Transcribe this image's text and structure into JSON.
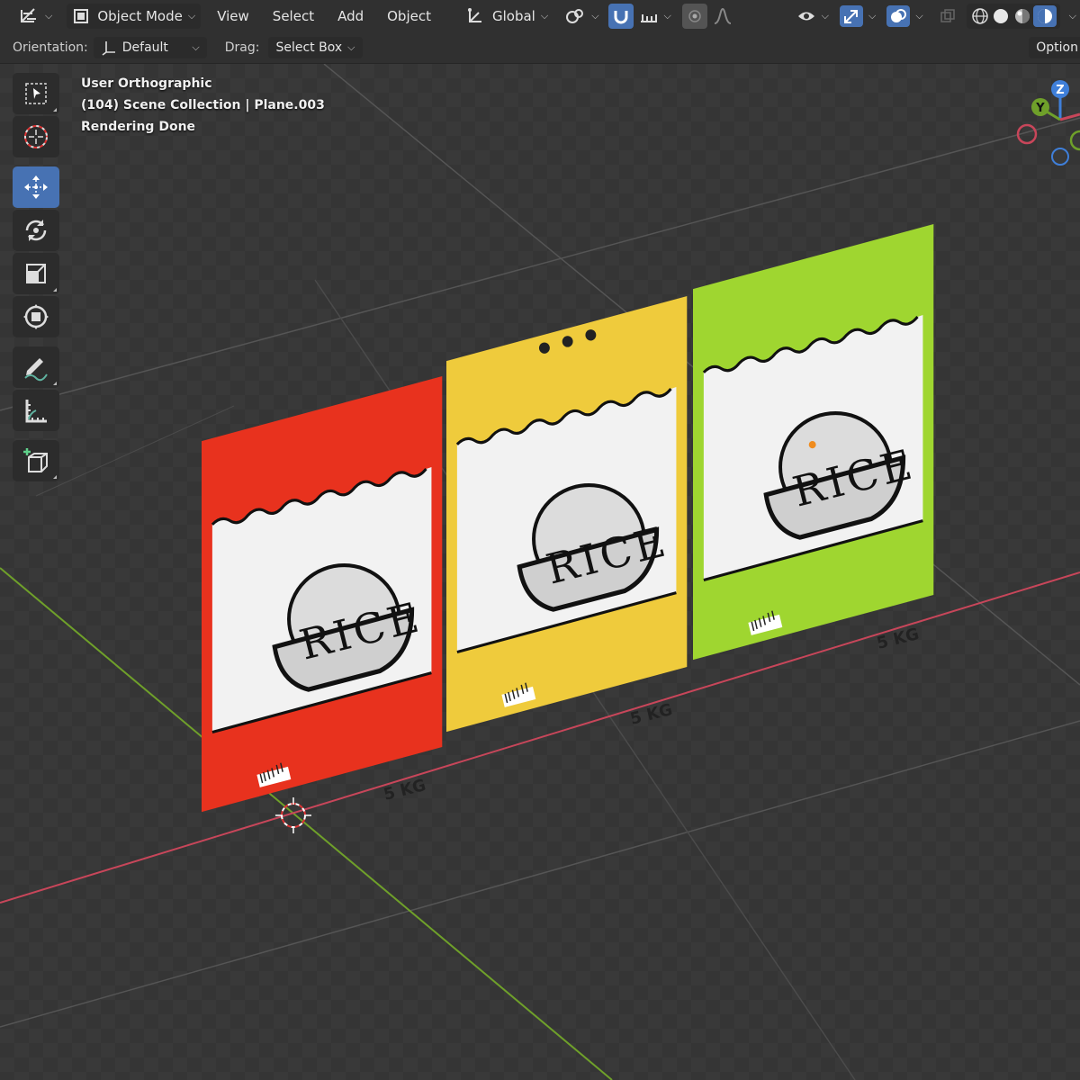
{
  "header": {
    "mode_label": "Object Mode",
    "menus": [
      "View",
      "Select",
      "Add",
      "Object"
    ],
    "transform_orientation": "Global",
    "options_label": "Option"
  },
  "tool_settings": {
    "orientation_label": "Orientation:",
    "orientation_value": "Default",
    "drag_label": "Drag:",
    "drag_value": "Select Box"
  },
  "viewport": {
    "view_name": "User Orthographic",
    "collection_info": "(104) Scene Collection | Plane.003",
    "status": "Rendering Done"
  },
  "gizmo": {
    "z_label": "Z",
    "y_label": "Y"
  },
  "bags": [
    {
      "label": "RICE",
      "weight": "5 KG",
      "color": "#e8321e"
    },
    {
      "label": "RICE",
      "weight": "5 KG",
      "color": "#efcb3c"
    },
    {
      "label": "RICE",
      "weight": "5 KG",
      "color": "#9fd630"
    }
  ],
  "colors": {
    "accent": "#4772b3",
    "x_axis": "#c8465a",
    "y_axis": "#6fa02a",
    "z_axis": "#3f7fd9"
  }
}
